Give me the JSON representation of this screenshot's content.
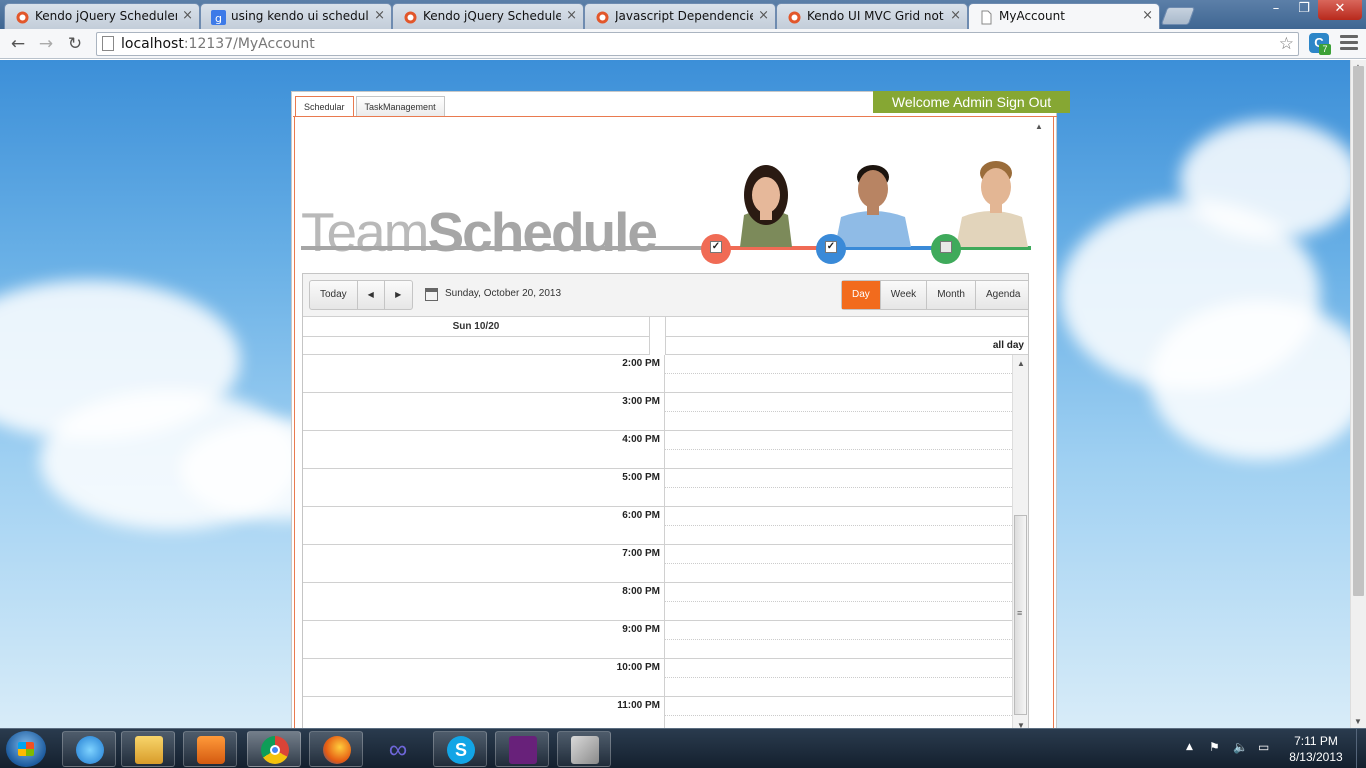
{
  "browser": {
    "tabs": [
      {
        "title": "Kendo jQuery Scheduler C",
        "icon": "kendo-icon",
        "active": false
      },
      {
        "title": "using kendo ui scheduler",
        "icon": "google-icon",
        "active": false
      },
      {
        "title": "Kendo jQuery Scheduler C",
        "icon": "kendo-icon",
        "active": false
      },
      {
        "title": "Javascript Dependencies",
        "icon": "kendo-icon",
        "active": false
      },
      {
        "title": "Kendo UI MVC Grid not di",
        "icon": "kendo-icon",
        "active": false
      },
      {
        "title": "MyAccount",
        "icon": "page-icon",
        "active": true
      }
    ],
    "url_host": "localhost",
    "url_rest": ":12137/MyAccount",
    "window_controls": {
      "minimize": "–",
      "maximize": "❐",
      "close": "✕"
    },
    "extension_badge": "7",
    "extension_letter": "C"
  },
  "page": {
    "tabs": [
      "Schedular",
      "TaskManagement"
    ],
    "welcome_text": "Welcome Admin",
    "signout_text": "Sign Out",
    "title_light": "Team",
    "title_bold": "Schedule",
    "people": [
      {
        "name": "person-1",
        "color": "#f06b55",
        "checked": true
      },
      {
        "name": "person-2",
        "color": "#3a8ad8",
        "checked": true
      },
      {
        "name": "person-3",
        "color": "#3faa5b",
        "checked": false
      }
    ],
    "checkmark": "✓"
  },
  "scheduler": {
    "today": "Today",
    "prev": "◀",
    "next": "▶",
    "date": "Sunday, October 20, 2013",
    "views": [
      {
        "label": "Day",
        "active": true
      },
      {
        "label": "Week",
        "active": false
      },
      {
        "label": "Month",
        "active": false
      },
      {
        "label": "Agenda",
        "active": false
      }
    ],
    "day_header": "Sun 10/20",
    "all_day": "all day",
    "times": [
      "2:00 PM",
      "3:00 PM",
      "4:00 PM",
      "5:00 PM",
      "6:00 PM",
      "7:00 PM",
      "8:00 PM",
      "9:00 PM",
      "10:00 PM",
      "11:00 PM"
    ]
  },
  "taskbar": {
    "apps": [
      "internet-explorer",
      "file-explorer",
      "media-player",
      "chrome",
      "firefox",
      "visual-studio-infinity",
      "skype",
      "visual-studio",
      "setup-tool"
    ],
    "time": "7:11 PM",
    "date": "8/13/2013",
    "tray_arrow": "▲",
    "accent": "#f26b1d"
  }
}
